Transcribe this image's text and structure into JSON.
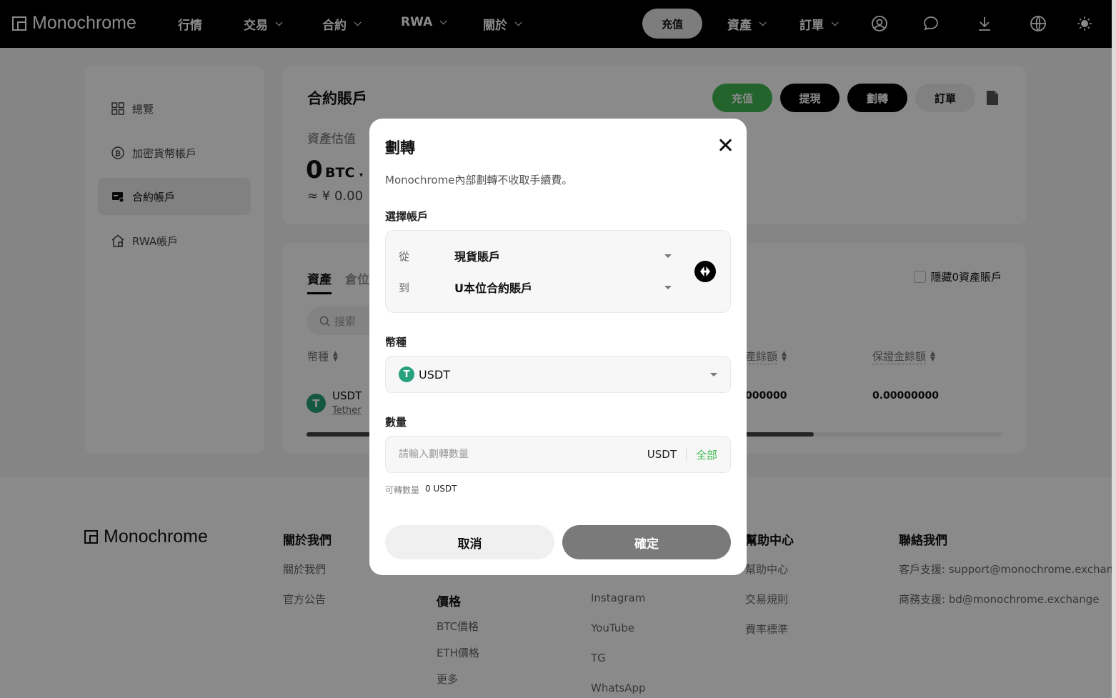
{
  "brand": "Monochrome",
  "nav": {
    "items": [
      {
        "label": "行情",
        "dropdown": false
      },
      {
        "label": "交易",
        "dropdown": true
      },
      {
        "label": "合約",
        "dropdown": true
      },
      {
        "label": "RWA",
        "dropdown": true
      },
      {
        "label": "關於",
        "dropdown": true
      }
    ],
    "deposit": "充值",
    "assets": "資產",
    "orders": "訂單",
    "icons": [
      "user-icon",
      "chat-icon",
      "download-icon",
      "globe-icon",
      "sun-icon"
    ]
  },
  "sidebar": {
    "items": [
      {
        "label": "總覽",
        "icon": "grid-icon"
      },
      {
        "label": "加密貨幣帳戶",
        "icon": "bitcoin-icon"
      },
      {
        "label": "合約帳戶",
        "icon": "contract-card-icon",
        "active": true
      },
      {
        "label": "RWA帳戶",
        "icon": "house-icon"
      }
    ]
  },
  "account": {
    "title": "合約賬戶",
    "actions": {
      "deposit": "充值",
      "withdraw": "提現",
      "transfer": "劃轉",
      "orders": "訂單"
    },
    "estimate_label": "資產估值",
    "estimate_value": "0",
    "estimate_unit": "BTC",
    "estimate_cny": "≈ ¥ 0.00"
  },
  "assets_table": {
    "tabs": [
      "資產",
      "倉位"
    ],
    "search_placeholder": "搜索",
    "hide_zero_label": "隱藏0資產賬戶",
    "columns": [
      "幣種",
      "產餘額",
      "保證金餘額"
    ],
    "row": {
      "symbol": "USDT",
      "name": "Tether",
      "balance": "000000",
      "margin": "0.00000000"
    },
    "scroll_fraction": 0.73
  },
  "modal": {
    "title": "劃轉",
    "description": "Monochrome內部劃轉不收取手續費。",
    "select_account_label": "選擇帳戶",
    "from_label": "從",
    "from_value": "現貨賬戶",
    "to_label": "到",
    "to_value": "U本位合約賬戶",
    "currency_label": "幣種",
    "currency_value": "USDT",
    "amount_label": "數量",
    "amount_placeholder": "請輸入劃轉數量",
    "amount_unit": "USDT",
    "all_label": "全部",
    "available_label": "可轉數量",
    "available_value": "0 USDT",
    "cancel": "取消",
    "confirm": "確定"
  },
  "footer": {
    "brand": "Monochrome",
    "col1": {
      "head": "關於我們",
      "links": [
        "關於我們",
        "官方公告"
      ]
    },
    "col2": {
      "head": "價格",
      "links": [
        "BTC價格",
        "ETH價格",
        "更多"
      ]
    },
    "col3": {
      "links": [
        "Instagram",
        "YouTube",
        "TG",
        "WhatsApp"
      ]
    },
    "col4": {
      "head": "幫助中心",
      "links": [
        "幫助中心",
        "交易規則",
        "費率標準"
      ]
    },
    "col5": {
      "head": "聯絡我們",
      "links": [
        "客戶支援: support@monochrome.exchange",
        "商務支援: bd@monochrome.exchange"
      ]
    }
  },
  "colors": {
    "accent_green": "#3fb950",
    "tether_green": "#26a17b",
    "nav_bg": "#000000"
  }
}
